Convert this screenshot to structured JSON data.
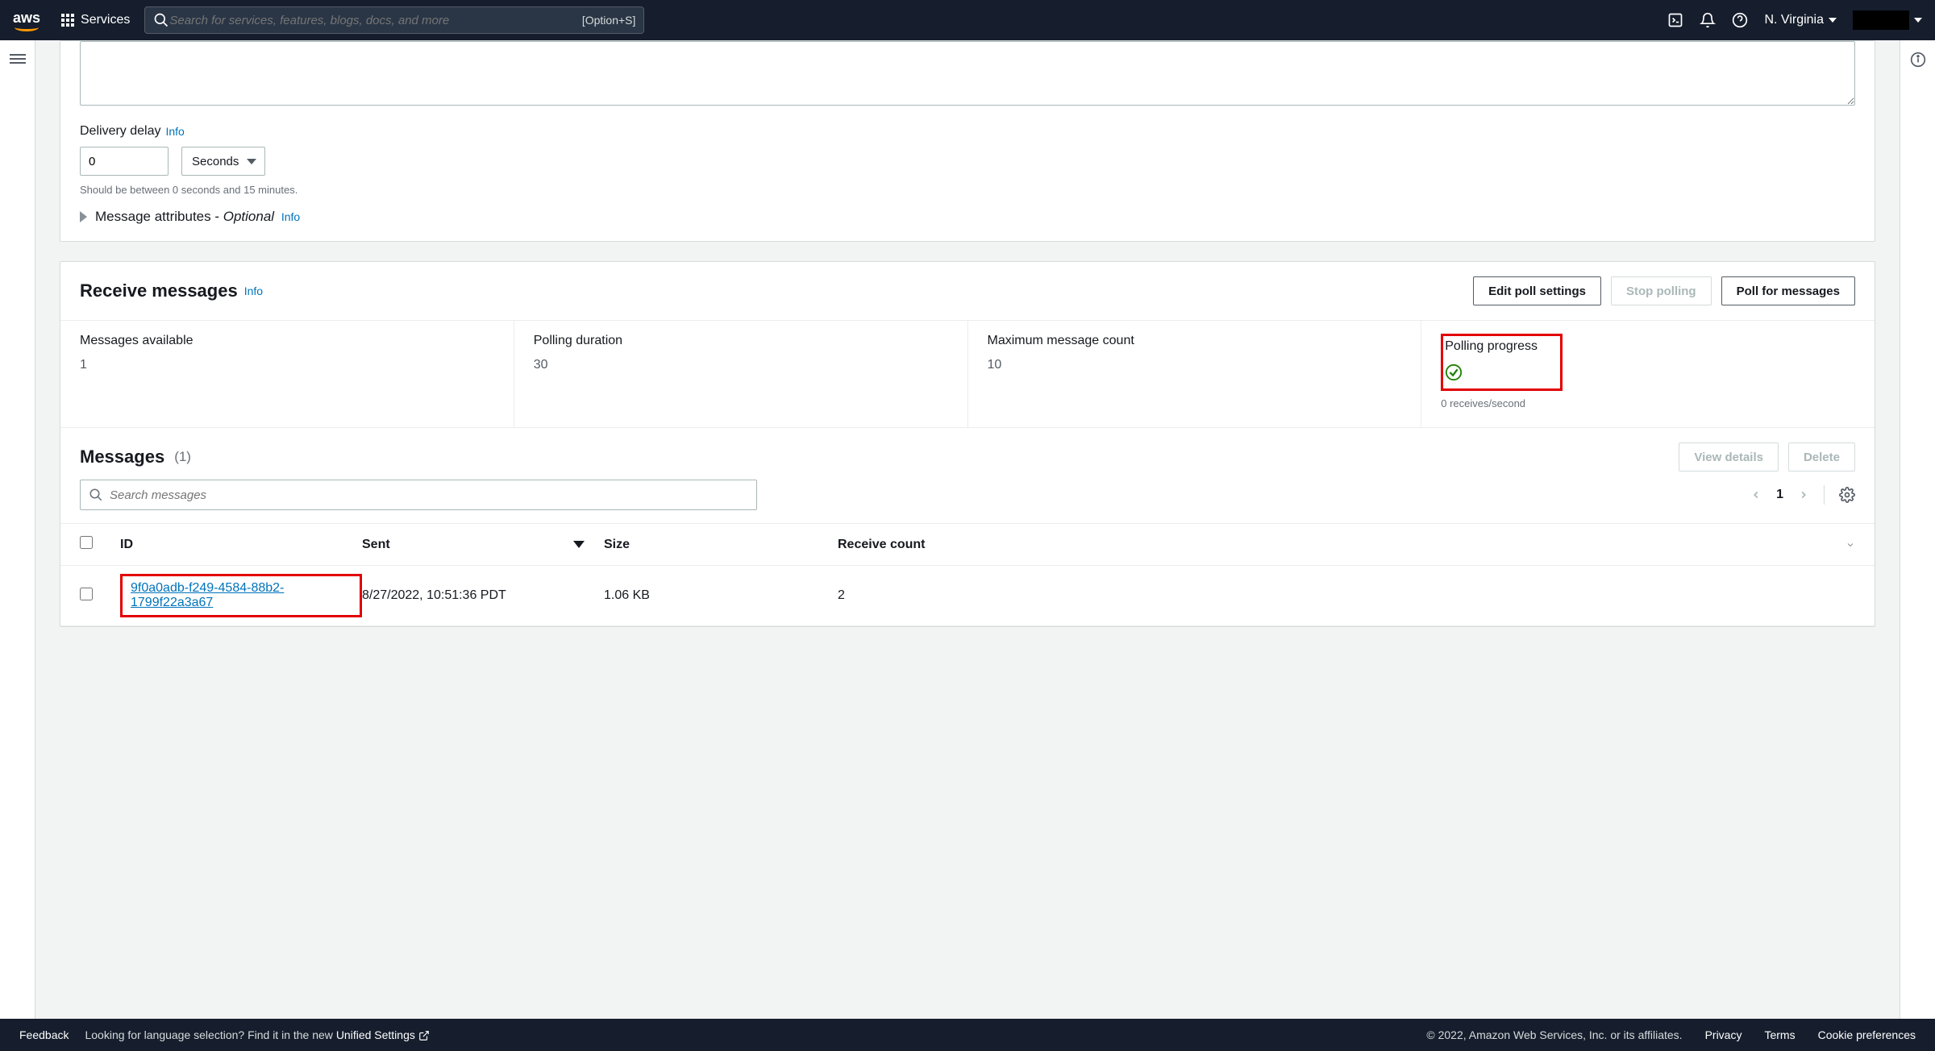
{
  "topnav": {
    "logo": "aws",
    "services": "Services",
    "search_placeholder": "Search for services, features, blogs, docs, and more",
    "search_shortcut": "[Option+S]",
    "region": "N. Virginia"
  },
  "send_panel": {
    "delivery_delay_label": "Delivery delay",
    "info": "Info",
    "delay_value": "0",
    "delay_unit": "Seconds",
    "delay_help": "Should be between 0 seconds and 15 minutes.",
    "attrs_label": "Message attributes - ",
    "attrs_optional": "Optional"
  },
  "receive_panel": {
    "title": "Receive messages",
    "info": "Info",
    "edit_btn": "Edit poll settings",
    "stop_btn": "Stop polling",
    "poll_btn": "Poll for messages",
    "stats": {
      "avail_label": "Messages available",
      "avail_value": "1",
      "dur_label": "Polling duration",
      "dur_value": "30",
      "max_label": "Maximum message count",
      "max_value": "10",
      "prog_label": "Polling progress",
      "prog_note": "0 receives/second"
    }
  },
  "messages": {
    "title": "Messages",
    "count": "(1)",
    "view_btn": "View details",
    "delete_btn": "Delete",
    "search_placeholder": "Search messages",
    "page": "1",
    "cols": {
      "id": "ID",
      "sent": "Sent",
      "size": "Size",
      "rc": "Receive count"
    },
    "rows": [
      {
        "id": "9f0a0adb-f249-4584-88b2-1799f22a3a67",
        "sent": "8/27/2022, 10:51:36 PDT",
        "size": "1.06 KB",
        "rc": "2"
      }
    ]
  },
  "footer": {
    "feedback": "Feedback",
    "lang_prefix": "Looking for language selection? Find it in the new ",
    "lang_link": "Unified Settings",
    "copyright": "© 2022, Amazon Web Services, Inc. or its affiliates.",
    "privacy": "Privacy",
    "terms": "Terms",
    "cookies": "Cookie preferences"
  }
}
